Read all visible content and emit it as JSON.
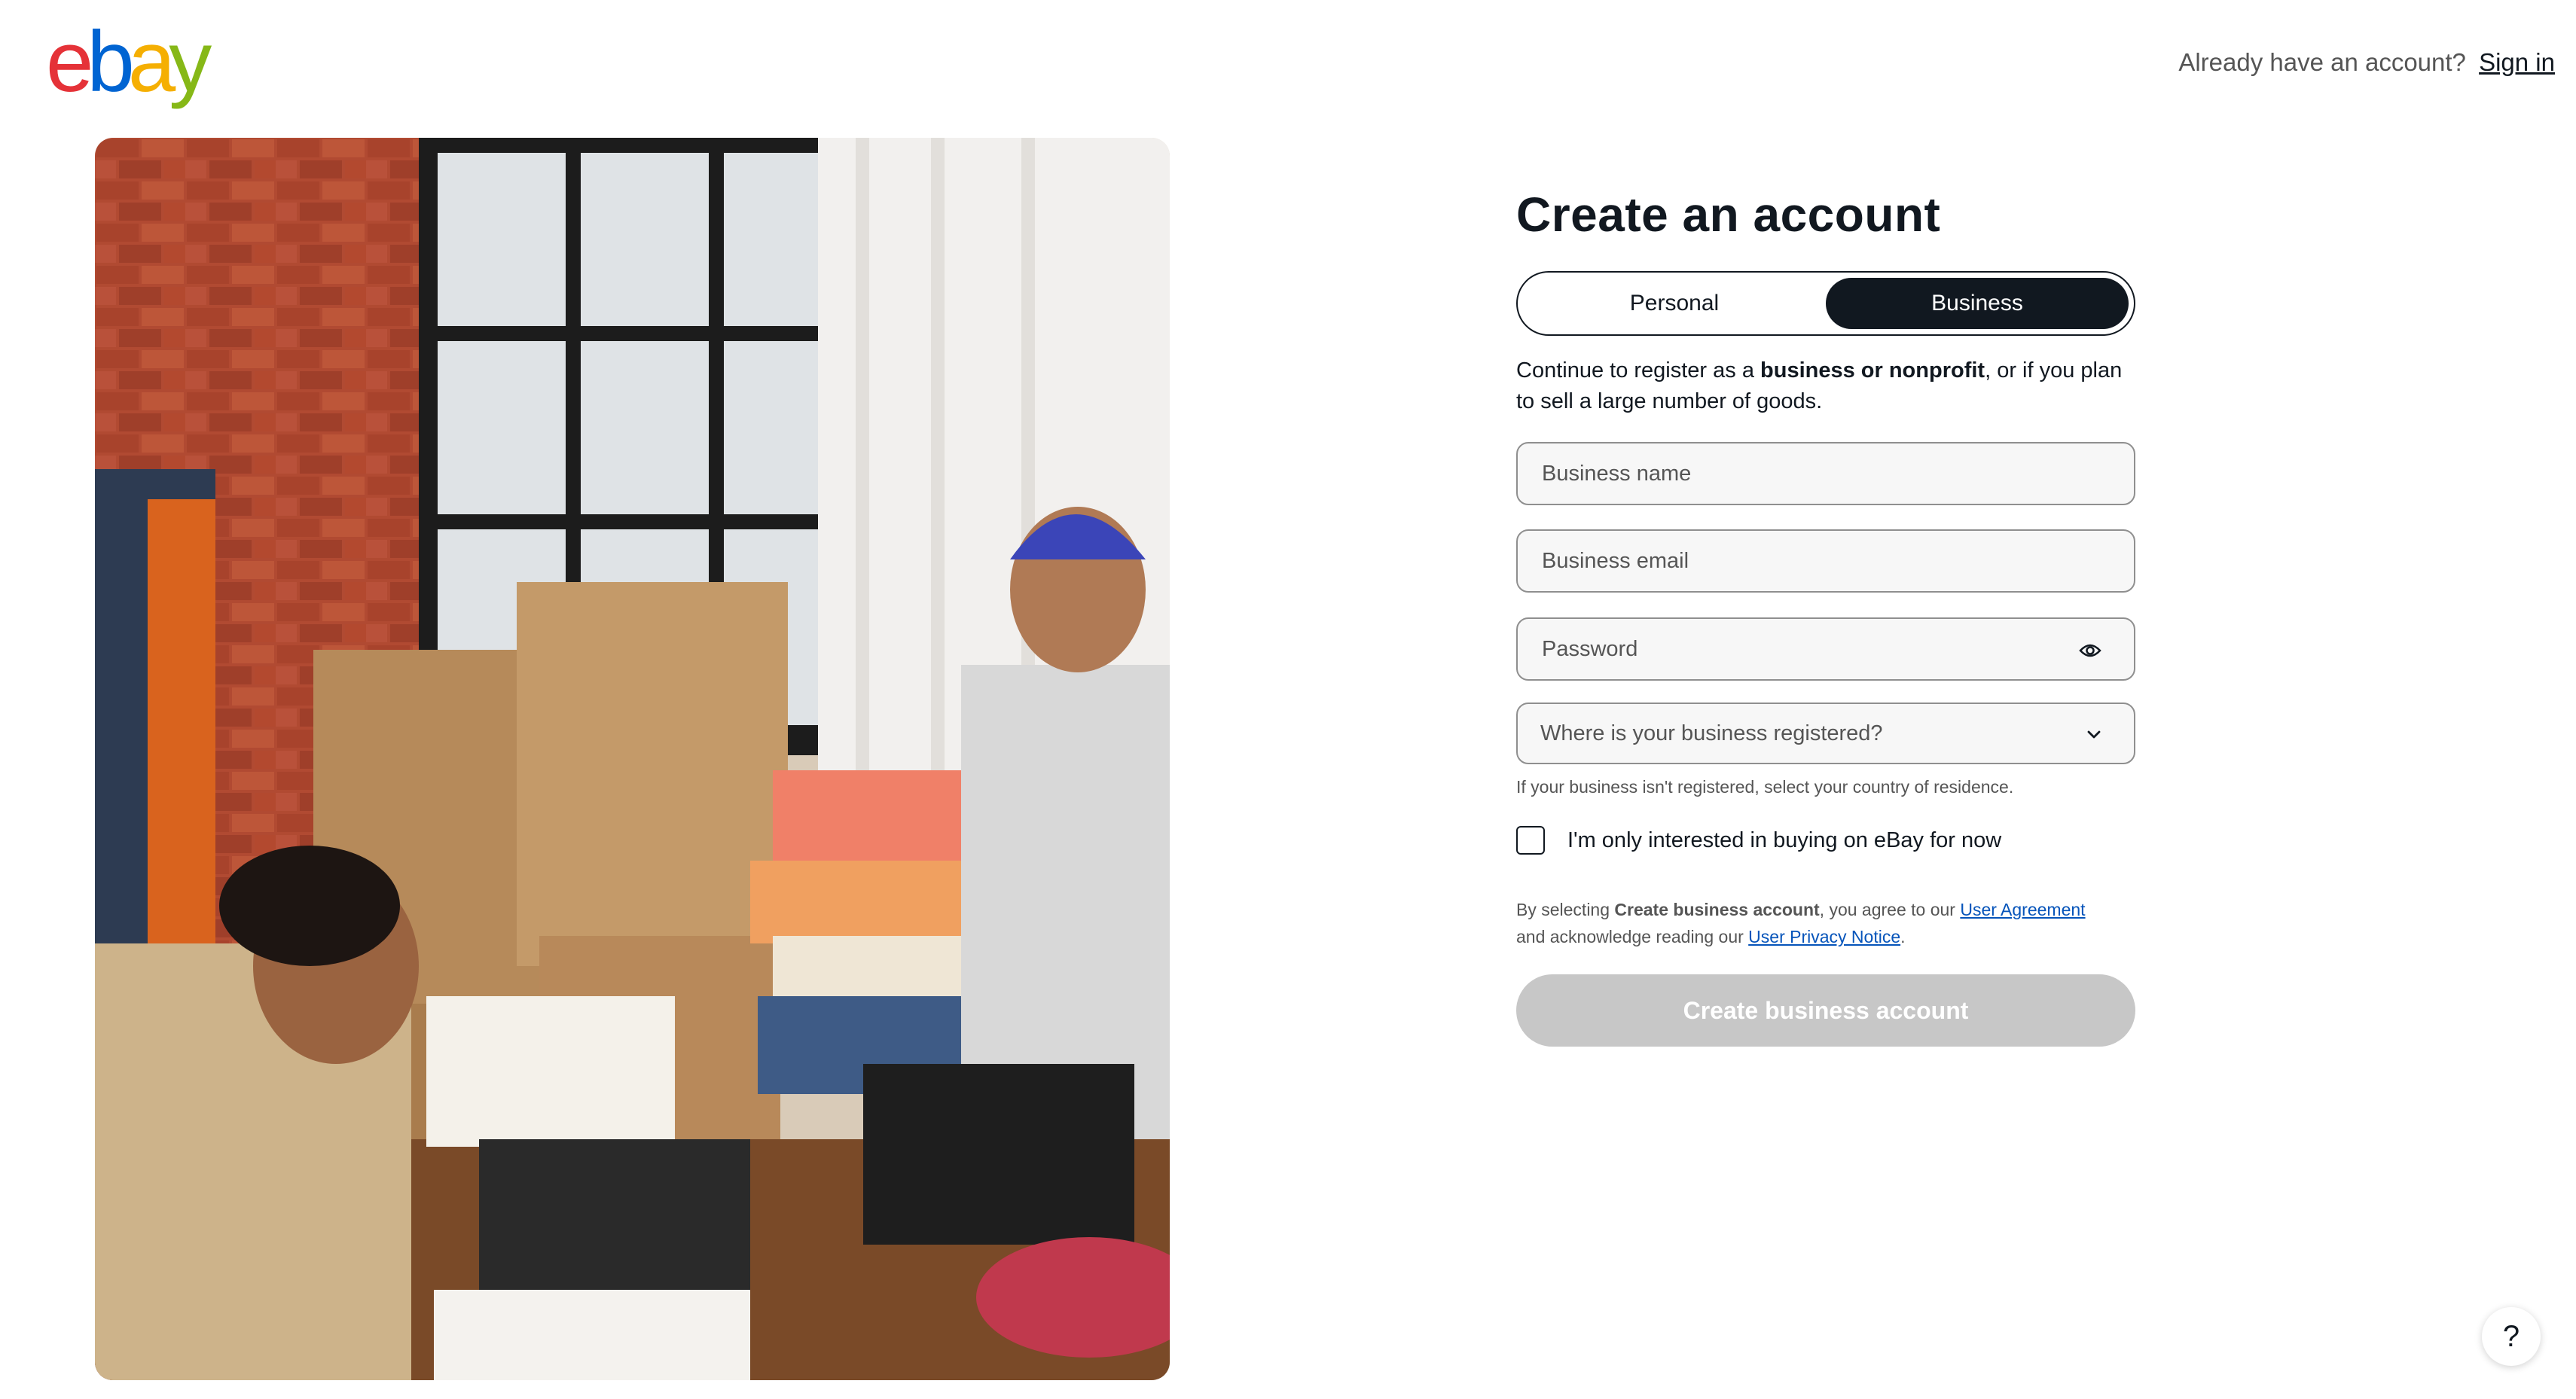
{
  "logo": {
    "letters": [
      "e",
      "b",
      "a",
      "y"
    ],
    "colors": [
      "#e53238",
      "#0064d2",
      "#f5af02",
      "#86b817"
    ]
  },
  "header": {
    "prompt": "Already have an account?",
    "signin_label": "Sign in"
  },
  "form": {
    "title": "Create an account",
    "account_types": [
      {
        "label": "Personal",
        "selected": false
      },
      {
        "label": "Business",
        "selected": true
      }
    ],
    "intro": {
      "pre": "Continue to register as a ",
      "bold": "business or nonprofit",
      "post": ", or if you plan to sell a large number of goods."
    },
    "fields": {
      "business_name": {
        "placeholder": "Business name",
        "value": ""
      },
      "business_email": {
        "placeholder": "Business email",
        "value": ""
      },
      "password": {
        "placeholder": "Password",
        "value": "",
        "toggle_icon": "eye-icon"
      }
    },
    "registration_select": {
      "placeholder": "Where is your business registered?",
      "icon": "chevron-down-icon"
    },
    "registration_helper": "If your business isn't registered, select your country of residence.",
    "buying_only": {
      "label": "I'm only interested in buying on eBay for now",
      "checked": false
    },
    "legal": {
      "pre": "By selecting ",
      "bold": "Create business account",
      "mid": ", you agree to our ",
      "agreement_link": "User Agreement",
      "mid2": " and acknowledge reading our ",
      "privacy_link": "User Privacy Notice",
      "post": "."
    },
    "submit_label": "Create business account",
    "submit_enabled": false
  },
  "help": {
    "label": "?",
    "icon": "help-icon"
  }
}
